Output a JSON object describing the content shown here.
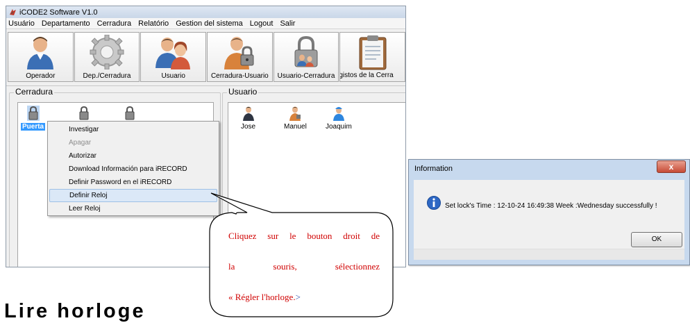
{
  "app": {
    "title": "iCODE2 Software V1.0",
    "menu": [
      "Usuário",
      "Departamento",
      "Cerradura",
      "Relatório",
      "Gestion del sistema",
      "Logout",
      "Salir"
    ],
    "toolbar": [
      {
        "label": "Operador",
        "icon": "operator-icon"
      },
      {
        "label": "Dep./Cerradura",
        "icon": "gears-icon"
      },
      {
        "label": "Usuario",
        "icon": "users-icon"
      },
      {
        "label": "Cerradura-Usuario",
        "icon": "lock-user-icon"
      },
      {
        "label": "Usuario-Cerradura",
        "icon": "user-lock-icon"
      },
      {
        "label": "gistos de la Cerra",
        "icon": "clipboard-icon"
      }
    ],
    "locks_panel": {
      "title": "Cerradura",
      "items": [
        {
          "label": "Puerta",
          "selected": true
        },
        {
          "label": "",
          "selected": false
        },
        {
          "label": "",
          "selected": false
        }
      ]
    },
    "users_panel": {
      "title": "Usuario",
      "items": [
        {
          "label": "Jose"
        },
        {
          "label": "Manuel"
        },
        {
          "label": "Joaquim"
        }
      ]
    },
    "context_menu": {
      "items": [
        {
          "label": "Investigar",
          "disabled": false,
          "highlighted": false
        },
        {
          "label": "Apagar",
          "disabled": true,
          "highlighted": false
        },
        {
          "label": "Autorizar",
          "disabled": false,
          "highlighted": false
        },
        {
          "label": "Download Información para iRECORD",
          "disabled": false,
          "highlighted": false
        },
        {
          "label": "Definir Password en el iRECORD",
          "disabled": false,
          "highlighted": false
        },
        {
          "label": "Definir Reloj",
          "disabled": false,
          "highlighted": true
        },
        {
          "label": "Leer Reloj",
          "disabled": false,
          "highlighted": false
        }
      ]
    }
  },
  "callout": {
    "line1": "Cliquez sur le bouton droit de",
    "line2": "la souris, sélectionnez",
    "line3_red": "« Régler l'horloge.",
    "line3_blue": ">"
  },
  "heading": "Lire horloge",
  "dialog": {
    "title": "Information",
    "close": "x",
    "message": "Set lock's Time : 12-10-24 16:49:38  Week :Wednesday  successfully !",
    "ok": "OK",
    "icon": "info-icon"
  },
  "colors": {
    "selection": "#3399ff",
    "callout_text": "#d00000",
    "callout_accent": "#2b4aa8",
    "close_button": "#c74b36"
  }
}
